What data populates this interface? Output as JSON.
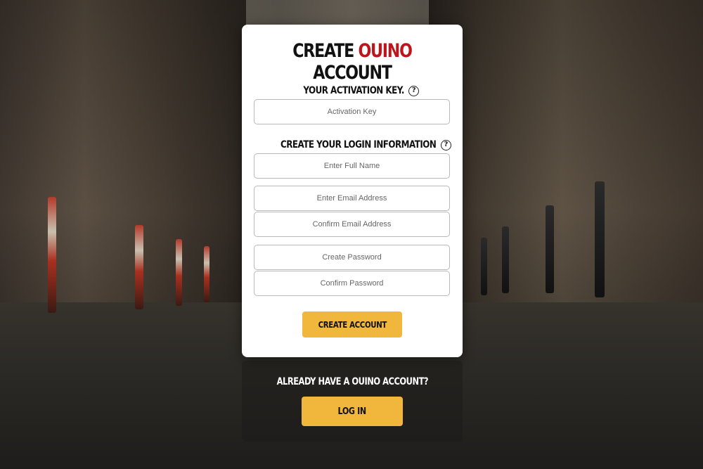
{
  "signup": {
    "title_prefix": "CREATE ",
    "title_brand": "OUINO",
    "title_suffix": " ACCOUNT",
    "activation_label": "YOUR ACTIVATION KEY.",
    "activation_placeholder": "Activation Key",
    "login_info_label": "CREATE YOUR LOGIN INFORMATION",
    "full_name_placeholder": "Enter Full Name",
    "email_placeholder": "Enter Email Address",
    "confirm_email_placeholder": "Confirm Email Address",
    "password_placeholder": "Create Password",
    "confirm_password_placeholder": "Confirm Password",
    "create_button_label": "CREATE ACCOUNT",
    "help_glyph": "?"
  },
  "footer": {
    "prompt": "ALREADY HAVE A OUINO ACCOUNT?",
    "login_button_label": "LOG IN"
  },
  "colors": {
    "brand_red": "#c0141c",
    "button_yellow": "#f0b73c"
  },
  "icons": {
    "help": "question-circle-icon"
  }
}
